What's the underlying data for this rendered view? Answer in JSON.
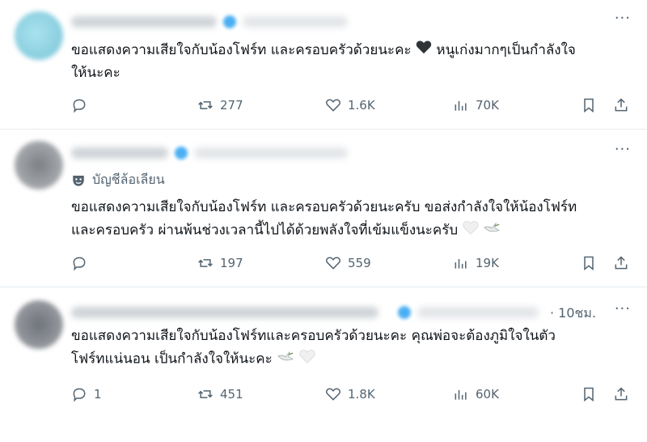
{
  "posts": [
    {
      "text_line1": "ขอแสดงความเสียใจกับน้องโฟร์ท และครอบครัวด้วยนะคะ",
      "text_line1b": "หนูเก่งมากๆเป็นกำลังใจ",
      "text_line2": "ให้นะคะ",
      "replies": "",
      "retweets": "277",
      "likes": "1.6K",
      "views": "70K"
    },
    {
      "parody_label": "บัญชีล้อเลียน",
      "text_line1": "ขอแสดงความเสียใจกับน้องโฟร์ท และครอบครัวด้วยนะครับ ขอส่งกำลังใจให้น้องโฟร์ท",
      "text_line2": "และครอบครัว ผ่านพ้นช่วงเวลานี้ไปได้ด้วยพลังใจที่เข้มแข็งนะครับ",
      "replies": "",
      "retweets": "197",
      "likes": "559",
      "views": "19K"
    },
    {
      "time": "· 10ชม.",
      "text_line1": "ขอแสดงความเสียใจกับน้องโฟร์ทและครอบครัวด้วยนะคะ คุณพ่อจะต้องภูมิใจในตัว",
      "text_line2": "โฟร์ทแน่นอน เป็นกำลังใจให้นะคะ",
      "replies": "1",
      "retweets": "451",
      "likes": "1.8K",
      "views": "60K"
    }
  ],
  "more_glyph": "···",
  "colors": {
    "secondary": "#536471",
    "accent": "#1d9bf0",
    "text": "#0f1419"
  }
}
